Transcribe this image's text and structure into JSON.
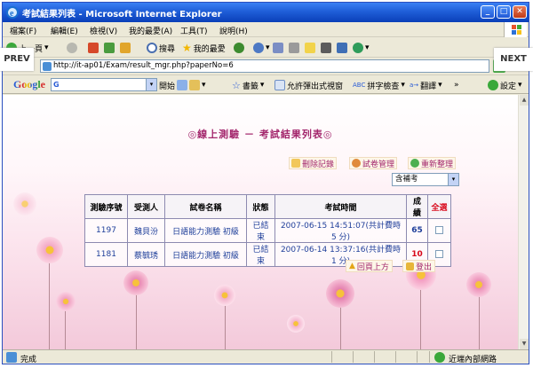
{
  "window": {
    "title": "考試結果列表 - Microsoft Internet Explorer",
    "buttons": {
      "minimize": "_",
      "maximize": "□",
      "close": "✕"
    }
  },
  "menu": [
    "檔案(F)",
    "編輯(E)",
    "檢視(V)",
    "我的最愛(A)",
    "工具(T)",
    "說明(H)"
  ],
  "toolbar": {
    "back": "上一頁",
    "search": "搜尋",
    "favorites": "我的最愛"
  },
  "address": {
    "url": "http://it-ap01/Exam/result_mgr.php?paperNo=6"
  },
  "overlay": {
    "prev": "PREV",
    "next": "NEXT"
  },
  "google_bar": {
    "logo": "Google",
    "search_prefix": "G",
    "start": "開始",
    "bookmarks": "書籤",
    "popup": "允許彈出式視窗",
    "spellcheck": "拼字檢查",
    "translate": "翻譯",
    "more": "»",
    "settings": "設定"
  },
  "page": {
    "title": "◎線上測驗 － 考試結果列表◎",
    "actions": {
      "delete": "刪除記錄",
      "manage": "試卷管理",
      "reorganize": "重新整理"
    },
    "filter": {
      "selected": "含補考"
    },
    "table": {
      "headers": [
        "測驗序號",
        "受測人",
        "試卷名稱",
        "狀態",
        "考試時間",
        "成績",
        "全選"
      ],
      "rows": [
        {
          "id": "1197",
          "name": "魏貝汾",
          "paper": "日語能力測驗 初級",
          "status": "已結束",
          "time": "2007-06-15 14:51:07(共計費時 5 分)",
          "score": "65"
        },
        {
          "id": "1181",
          "name": "蔡毓琇",
          "paper": "日語能力測驗 初級",
          "status": "已結束",
          "time": "2007-06-14 13:37:16(共計費時 1 分)",
          "score": "10"
        }
      ]
    },
    "bottom": {
      "back_top": "回頁上方",
      "logout": "登出"
    }
  },
  "status": {
    "left": "完成",
    "zone": "近端內部網路"
  }
}
